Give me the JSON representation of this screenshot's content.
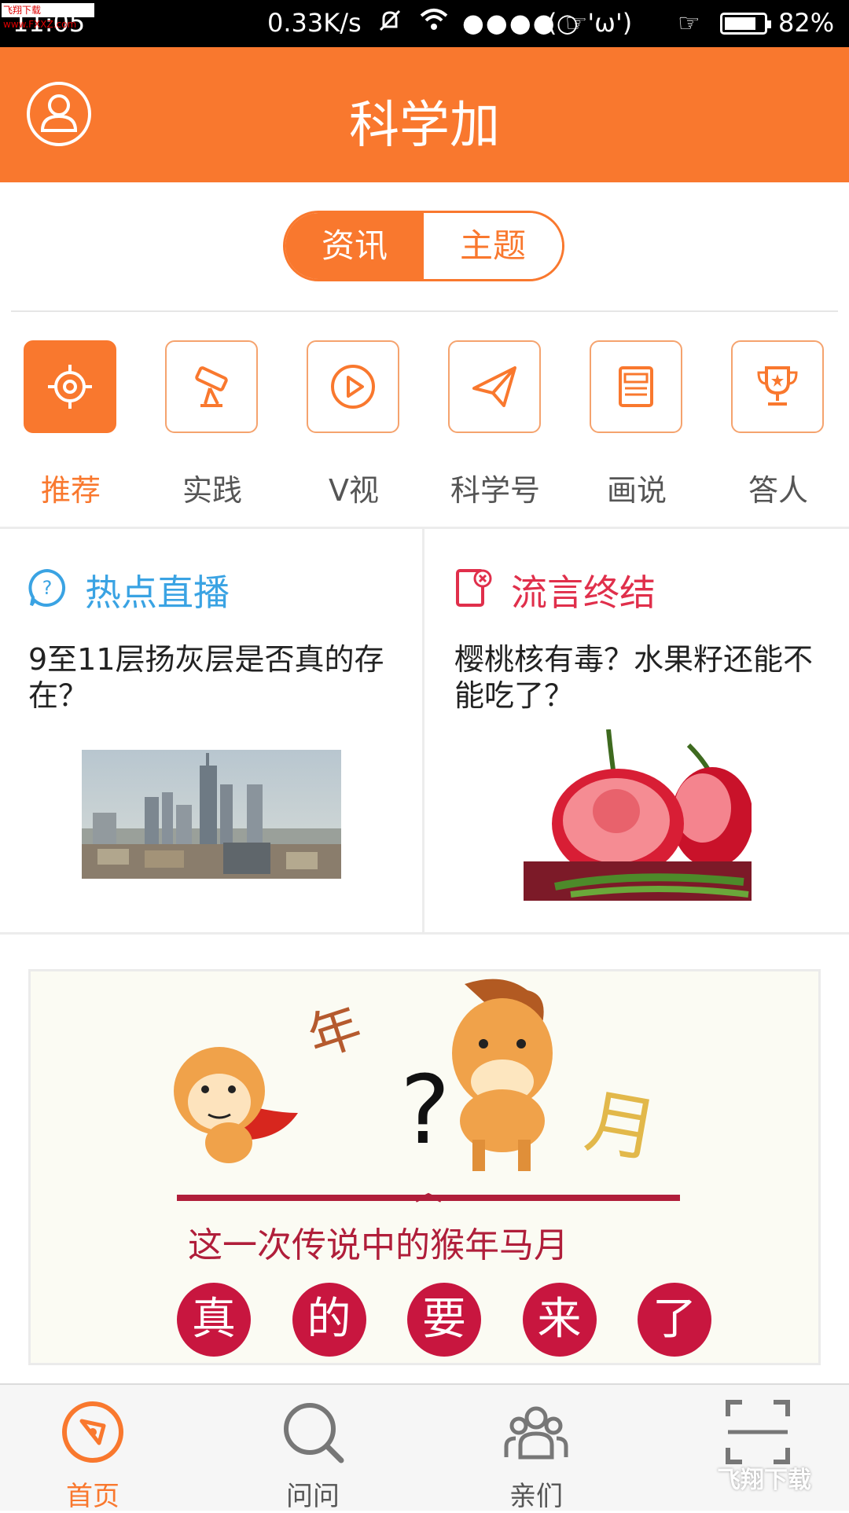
{
  "status_bar": {
    "time": "11:05",
    "speed": "0.33K/s",
    "signal": "●●●●○",
    "kaomoji": "( ☞'ω')",
    "hand": "☞",
    "battery_pct": "82%",
    "battery_level": 0.82,
    "watermark": "飞翔下载 www.FXXZ.com"
  },
  "header": {
    "title": "科学加",
    "accent": "#f9782e"
  },
  "segment": {
    "tabs": [
      "资讯",
      "主题"
    ],
    "selected": "资讯"
  },
  "categories": [
    {
      "label": "推荐",
      "icon": "target-icon",
      "active": true
    },
    {
      "label": "实践",
      "icon": "telescope-icon",
      "active": false
    },
    {
      "label": "V视",
      "icon": "play-icon",
      "active": false
    },
    {
      "label": "科学号",
      "icon": "paper-plane-icon",
      "active": false
    },
    {
      "label": "画说",
      "icon": "newspaper-icon",
      "active": false
    },
    {
      "label": "答人",
      "icon": "trophy-icon",
      "active": false
    }
  ],
  "cards": [
    {
      "heading": "热点直播",
      "icon": "question-bubble-icon",
      "color": "#3aa3e3",
      "title": "9至11层扬灰层是否真的存在？",
      "image": "city-skyline-image"
    },
    {
      "heading": "流言终结",
      "icon": "rumor-phone-icon",
      "color": "#e02f4b",
      "title": "樱桃核有毒？水果籽还能不能吃了？",
      "image": "cherries-image"
    }
  ],
  "banner": {
    "char_year": "年",
    "char_month": "月",
    "question": "?",
    "subtitle": "这一次传说中的猴年马月",
    "circles": [
      "真",
      "的",
      "要",
      "来",
      "了"
    ],
    "circle_color": "#c8163f"
  },
  "tab_bar": [
    {
      "label": "首页",
      "icon": "compass-icon",
      "active": true
    },
    {
      "label": "问问",
      "icon": "search-icon",
      "active": false
    },
    {
      "label": "亲们",
      "icon": "people-icon",
      "active": false
    },
    {
      "label": "",
      "icon": "scan-icon",
      "active": false
    }
  ],
  "footer_watermark": "飞翔下载"
}
